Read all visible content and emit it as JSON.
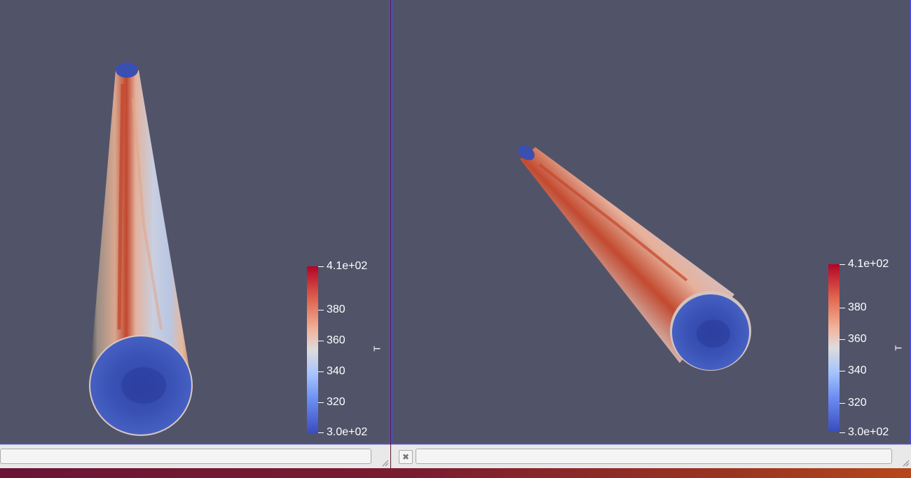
{
  "colors": {
    "viewport_bg": "#515369",
    "active_border": "#4a4ad8",
    "statusbar_bg": "#e9e9e9",
    "colormap_high": "#b40426",
    "colormap_mid": "#dddcdc",
    "colormap_low": "#3b4cc0"
  },
  "views": [
    {
      "scalar_bar": {
        "title": "T",
        "labels": [
          "4.1e+02",
          "380",
          "360",
          "340",
          "320",
          "3.0e+02"
        ]
      }
    },
    {
      "scalar_bar": {
        "title": "T",
        "labels": [
          "4.1e+02",
          "380",
          "360",
          "340",
          "320",
          "3.0e+02"
        ]
      }
    }
  ],
  "icons": {
    "close": "close-icon",
    "resize_grip": "resize-grip-icon"
  }
}
